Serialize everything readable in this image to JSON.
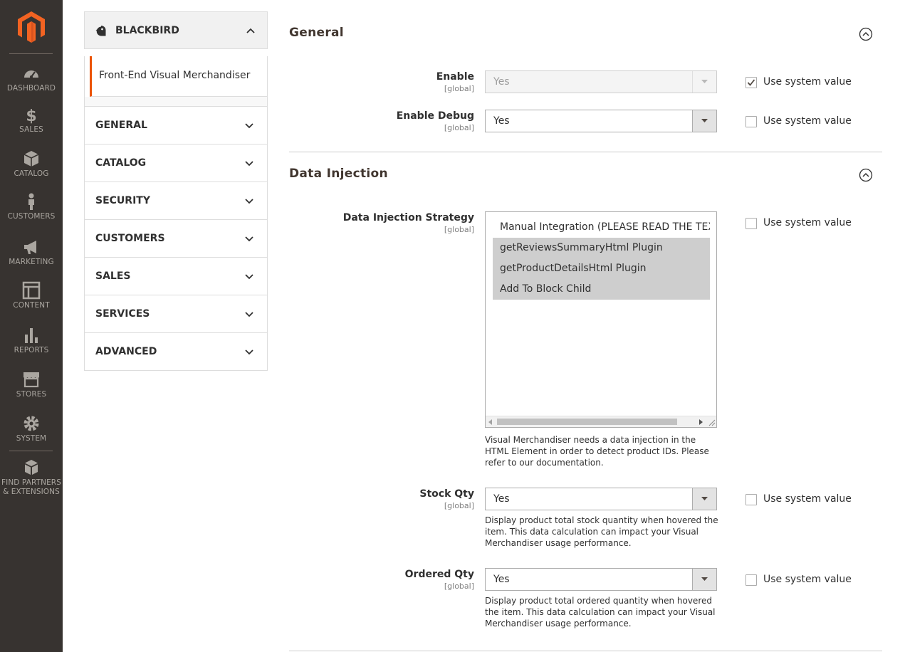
{
  "admin_menu": {
    "logo": "magento-logo",
    "items": [
      {
        "label": "DASHBOARD",
        "icon": "dashboard-icon"
      },
      {
        "label": "SALES",
        "icon": "dollar-icon"
      },
      {
        "label": "CATALOG",
        "icon": "box-icon"
      },
      {
        "label": "CUSTOMERS",
        "icon": "person-icon"
      },
      {
        "label": "MARKETING",
        "icon": "megaphone-icon"
      },
      {
        "label": "CONTENT",
        "icon": "layout-icon"
      },
      {
        "label": "REPORTS",
        "icon": "bar-chart-icon"
      },
      {
        "label": "STORES",
        "icon": "storefront-icon"
      },
      {
        "label": "SYSTEM",
        "icon": "gear-icon"
      },
      {
        "label": "FIND PARTNERS",
        "label2": "& EXTENSIONS",
        "icon": "extensions-icon"
      }
    ]
  },
  "tabs": {
    "vendor": "BLACKBIRD",
    "vendor_sub": "Front-End Visual Merchandiser",
    "sections": [
      "GENERAL",
      "CATALOG",
      "SECURITY",
      "CUSTOMERS",
      "SALES",
      "SERVICES",
      "ADVANCED"
    ]
  },
  "general": {
    "title": "General",
    "enable": {
      "label": "Enable",
      "scope": "[global]",
      "value": "Yes",
      "use_system": true
    },
    "debug": {
      "label": "Enable Debug",
      "scope": "[global]",
      "value": "Yes",
      "use_system": false
    }
  },
  "injection": {
    "title": "Data Injection",
    "strategy": {
      "label": "Data Injection Strategy",
      "scope": "[global]",
      "options": [
        {
          "text": "Manual Integration (PLEASE READ THE TEXT BELOW)",
          "selected": false
        },
        {
          "text": "getReviewsSummaryHtml Plugin",
          "selected": true
        },
        {
          "text": "getProductDetailsHtml Plugin",
          "selected": true
        },
        {
          "text": "Add To Block Child",
          "selected": true
        }
      ],
      "note": "Visual Merchandiser needs a data injection in the HTML Element in order to detect product IDs. Please refer to our documentation.",
      "use_system": false
    },
    "stock": {
      "label": "Stock Qty",
      "scope": "[global]",
      "value": "Yes",
      "note": "Display product total stock quantity when hovered the item. This data calculation can impact your Visual Merchandiser usage performance.",
      "use_system": false
    },
    "ordered": {
      "label": "Ordered Qty",
      "scope": "[global]",
      "value": "Yes",
      "note": "Display product total ordered quantity when hovered the item. This data calculation can impact your Visual Merchandiser usage performance.",
      "use_system": false
    }
  },
  "use_system_label": "Use system value",
  "colors": {
    "menu_bg": "#373330",
    "accent": "#eb5202",
    "menu_text": "#aaa6a0"
  }
}
